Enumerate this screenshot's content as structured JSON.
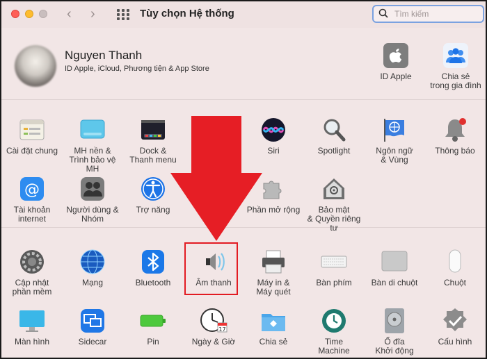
{
  "window": {
    "title": "Tùy chọn Hệ thống"
  },
  "search": {
    "placeholder": "Tìm kiếm"
  },
  "account": {
    "name": "Nguyen Thanh",
    "subtitle": "ID Apple, iCloud, Phương tiện & App Store",
    "apple_id_label": "ID Apple",
    "family_label_1": "Chia sẻ",
    "family_label_2": "trong gia đình"
  },
  "row1": [
    {
      "l1": "Cài đặt chung",
      "l2": ""
    },
    {
      "l1": "MH nền &",
      "l2": "Trình bảo vệ MH"
    },
    {
      "l1": "Dock &",
      "l2": "Thanh menu"
    },
    {
      "l1": "Siri",
      "l2": ""
    },
    {
      "l1": "Spotlight",
      "l2": ""
    },
    {
      "l1": "Ngôn ngữ",
      "l2": "& Vùng"
    },
    {
      "l1": "Thông báo",
      "l2": ""
    }
  ],
  "row2": [
    {
      "l1": "Tài khoản",
      "l2": "internet"
    },
    {
      "l1": "Người dùng &",
      "l2": "Nhóm"
    },
    {
      "l1": "Trợ năng",
      "l2": ""
    },
    {
      "l1": "Phần mở rộng",
      "l2": ""
    },
    {
      "l1": "Bảo mật",
      "l2": "& Quyền riêng tư"
    }
  ],
  "row3": [
    {
      "l1": "Cập nhật",
      "l2": "phần mềm"
    },
    {
      "l1": "Mạng",
      "l2": ""
    },
    {
      "l1": "Bluetooth",
      "l2": ""
    },
    {
      "l1": "Âm thanh",
      "l2": ""
    },
    {
      "l1": "Máy in &",
      "l2": "Máy quét"
    },
    {
      "l1": "Bàn phím",
      "l2": ""
    },
    {
      "l1": "Bàn di chuột",
      "l2": ""
    },
    {
      "l1": "Chuột",
      "l2": ""
    }
  ],
  "row4": [
    {
      "l1": "Màn hình",
      "l2": ""
    },
    {
      "l1": "Sidecar",
      "l2": ""
    },
    {
      "l1": "Pin",
      "l2": ""
    },
    {
      "l1": "Ngày & Giờ",
      "l2": ""
    },
    {
      "l1": "Chia sẻ",
      "l2": ""
    },
    {
      "l1": "Time",
      "l2": "Machine"
    },
    {
      "l1": "Ổ đĩa",
      "l2": "Khởi động"
    },
    {
      "l1": "Cấu hình",
      "l2": ""
    }
  ],
  "calendar_day": "17",
  "colors": {
    "highlight": "#e21b22",
    "arrow": "#e61e25"
  }
}
